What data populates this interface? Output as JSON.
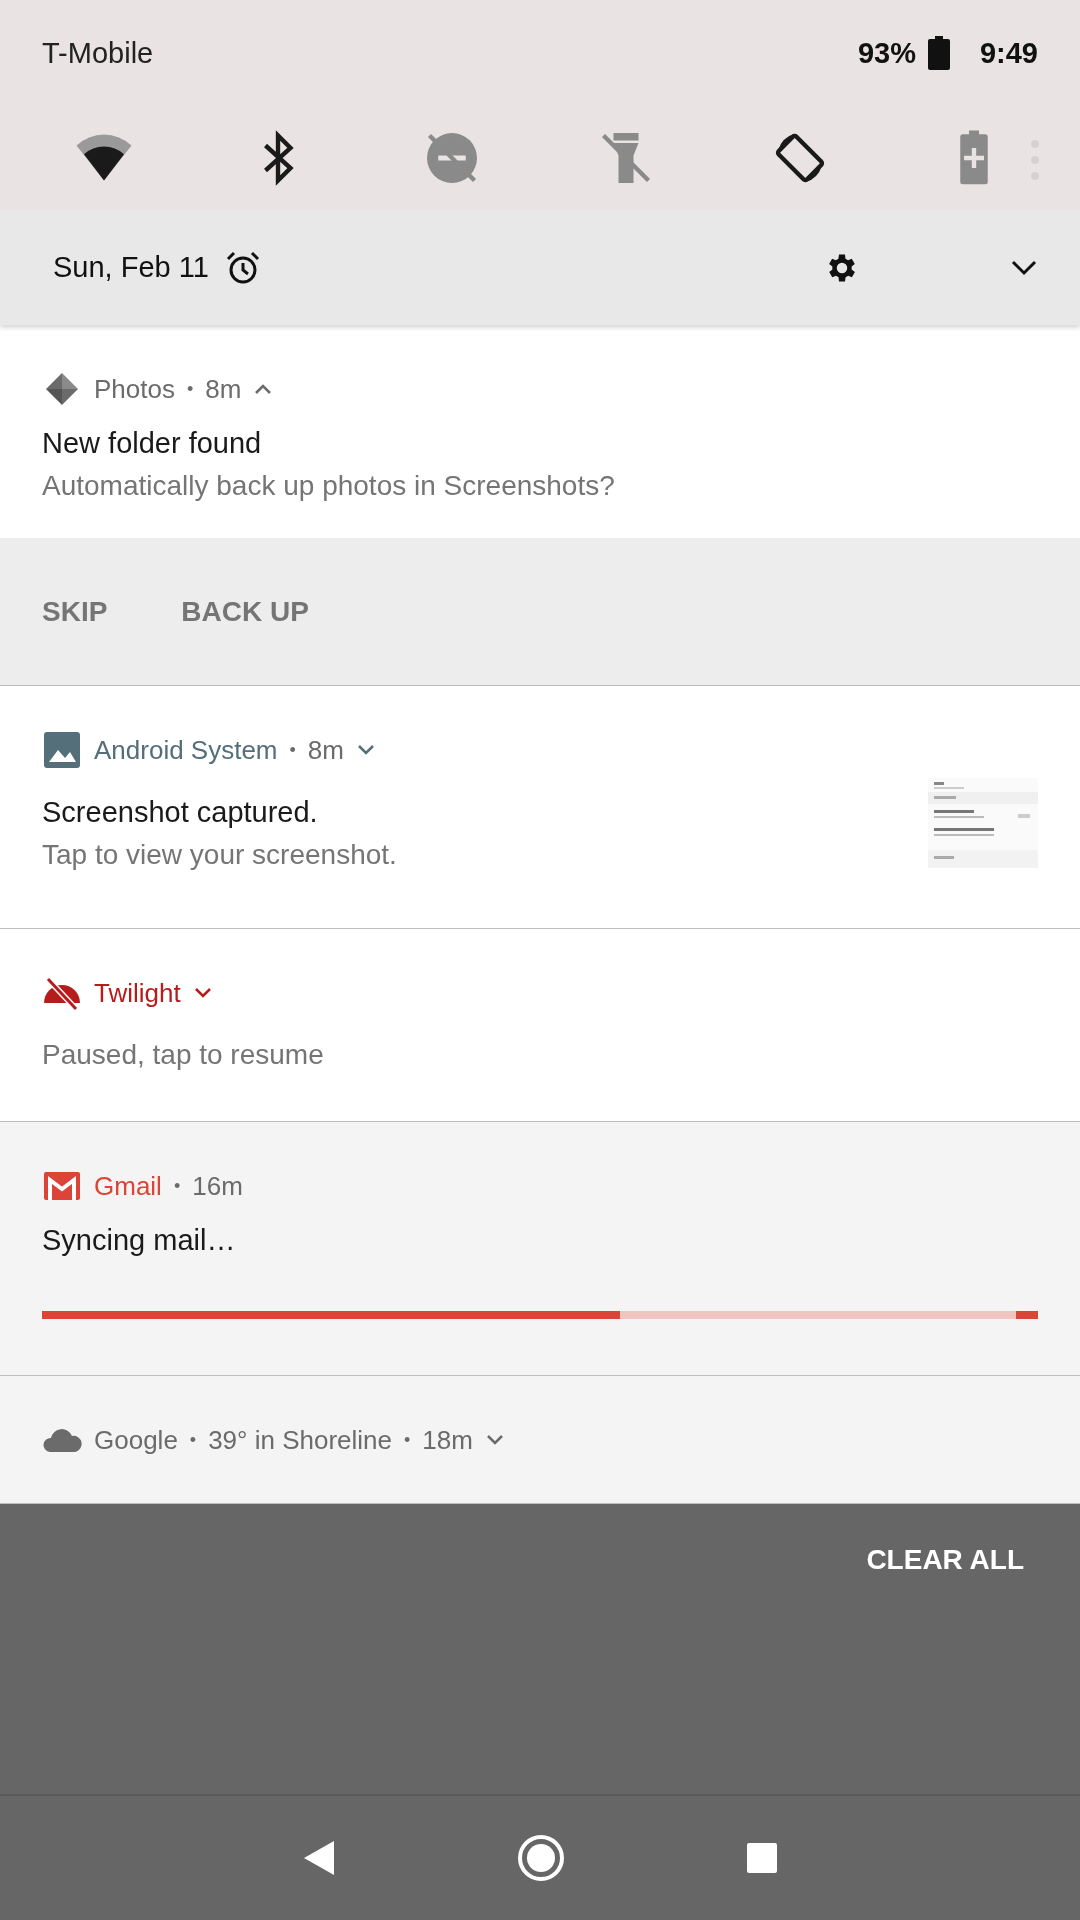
{
  "status_bar": {
    "carrier": "T-Mobile",
    "battery": "93%",
    "time": "9:49"
  },
  "quick_tiles": [
    {
      "kind": "wifi",
      "on": true
    },
    {
      "kind": "bluetooth",
      "on": true
    },
    {
      "kind": "dnd",
      "on": false
    },
    {
      "kind": "flashlight",
      "on": false
    },
    {
      "kind": "rotate",
      "on": true
    },
    {
      "kind": "battery_saver",
      "on": false
    }
  ],
  "header": {
    "date": "Sun, Feb 11"
  },
  "notifications": [
    {
      "kind": "actions",
      "app": "Photos",
      "details": [
        "•",
        "8m"
      ],
      "expanded": true,
      "title": "New folder found",
      "text": "Automatically back up photos in Screenshots?",
      "actions": [
        "SKIP",
        "BACK UP"
      ]
    },
    {
      "kind": "thumbnail",
      "app": "Android System",
      "details": [
        "•",
        "8m"
      ],
      "expanded": false,
      "title": "Screenshot captured.",
      "text": "Tap to view your screenshot."
    },
    {
      "kind": "plain",
      "app": "Twilight",
      "expanded": false,
      "text": "Paused, tap to resume"
    },
    {
      "kind": "progress",
      "app": "Gmail",
      "details": [
        "•",
        "16m"
      ],
      "title": "Syncing mail…",
      "level": 0.58
    },
    {
      "kind": "plain",
      "app": "Google",
      "details": [
        "•",
        "39° in Shoreline",
        "•",
        "18m"
      ],
      "expanded": false
    }
  ],
  "clear_all": "CLEAR ALL"
}
